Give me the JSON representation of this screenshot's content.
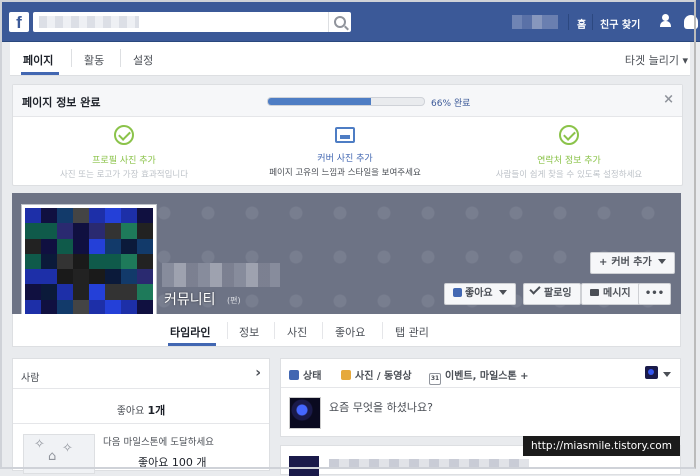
{
  "topbar": {
    "logo": "f",
    "home_label": "홈",
    "find_friends_label": "친구 찾기"
  },
  "page_nav": {
    "items": [
      {
        "label": "페이지",
        "active": true
      },
      {
        "label": "활동",
        "active": false
      },
      {
        "label": "설정",
        "active": false
      }
    ],
    "target_likes": "타겟 늘리기 ▾"
  },
  "info_panel": {
    "title": "페이지 정보 완료",
    "progress_percent": 66,
    "progress_label": "66% 완료",
    "close": "×",
    "steps": [
      {
        "title": "프로필 사진 추가",
        "desc": "사진 또는 로고가 가장 효과적입니다",
        "done": true
      },
      {
        "title": "커버 사진 추가",
        "desc": "페이지 고유의 느낌과 스타일을 보여주세요",
        "done": false
      },
      {
        "title": "연락처 정보 추가",
        "desc": "사람들이 쉽게 찾을 수 있도록 설정하세요",
        "done": true
      }
    ]
  },
  "cover": {
    "page_name": "커뮤니티",
    "page_name_sub": "(편)",
    "add_cover_label": "커버 추가",
    "like_label": "좋아요",
    "following_label": "팔로잉",
    "message_label": "메시지",
    "more_label": "•••"
  },
  "timeline_tabs": [
    {
      "label": "타임라인",
      "active": true
    },
    {
      "label": "정보",
      "active": false
    },
    {
      "label": "사진",
      "active": false
    },
    {
      "label": "좋아요",
      "active": false
    },
    {
      "label": "탭 관리",
      "active": false
    }
  ],
  "people_card": {
    "title": "사람",
    "chevron": "›",
    "likes_text": "좋아요",
    "likes_count": "1개",
    "milestone_text": "다음 마일스톤에 도달하세요",
    "milestone_goal": "좋아요 100 개"
  },
  "composer": {
    "tabs": [
      {
        "label": "상태",
        "icon": "pencil-icon",
        "color": "#4267b2"
      },
      {
        "label": "사진 / 동영상",
        "icon": "photo-icon",
        "color": "#e6a93b"
      },
      {
        "label": "이벤트, 마일스톤 +",
        "icon": "calendar-icon",
        "color": "#90949c"
      }
    ],
    "calendar_day": "31",
    "placeholder": "요즘 무엇을 하셨나요?"
  },
  "watermark": "http://miasmile.tistory.com",
  "colors": {
    "facebook_blue": "#3b5998",
    "accent_blue": "#4267b2",
    "check_green": "#8bc34a",
    "cover_gray": "#6d7385"
  }
}
